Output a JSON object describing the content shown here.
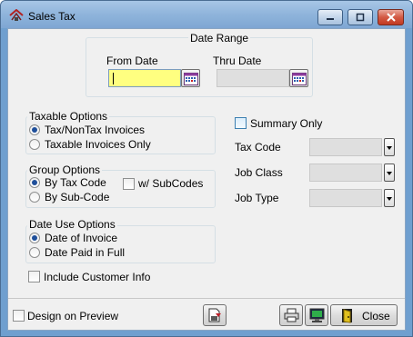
{
  "window": {
    "title": "Sales Tax",
    "controls": {
      "minimize": "minimize",
      "maximize": "maximize",
      "close": "close"
    }
  },
  "date_range": {
    "group_label": "Date Range",
    "from_date": {
      "label": "From Date",
      "value": ""
    },
    "thru_date": {
      "label": "Thru Date",
      "value": ""
    }
  },
  "taxable_options": {
    "group_label": "Taxable Options",
    "options": [
      {
        "label": "Tax/NonTax Invoices",
        "selected": true
      },
      {
        "label": "Taxable Invoices Only",
        "selected": false
      }
    ]
  },
  "group_options": {
    "group_label": "Group Options",
    "options": [
      {
        "label": "By Tax Code",
        "selected": true
      },
      {
        "label": "By Sub-Code",
        "selected": false
      }
    ],
    "subcodes_checkbox": {
      "label": "w/ SubCodes",
      "checked": false
    }
  },
  "date_use_options": {
    "group_label": "Date Use Options",
    "options": [
      {
        "label": "Date of Invoice",
        "selected": true
      },
      {
        "label": "Date Paid in Full",
        "selected": false
      }
    ]
  },
  "include_customer_info": {
    "label": "Include Customer Info",
    "checked": false
  },
  "summary_only": {
    "label": "Summary Only",
    "checked": false
  },
  "filters": [
    {
      "label": "Tax Code",
      "value": ""
    },
    {
      "label": "Job Class",
      "value": ""
    },
    {
      "label": "Job Type",
      "value": ""
    }
  ],
  "footer": {
    "design_on_preview": {
      "label": "Design on Preview",
      "checked": false
    },
    "close_button": "Close"
  },
  "icons": {
    "app": "sales-tax-app-icon",
    "calendar": "calendar-icon",
    "export": "export-file-icon",
    "print": "printer-icon",
    "preview": "monitor-preview-icon",
    "close": "door-exit-icon",
    "dropdown": "chevron-down-icon"
  },
  "colors": {
    "active_field": "#ffff80",
    "disabled_field": "#dfdfdf",
    "title_bar": "#8fb4db",
    "close_control": "#c23a22"
  }
}
